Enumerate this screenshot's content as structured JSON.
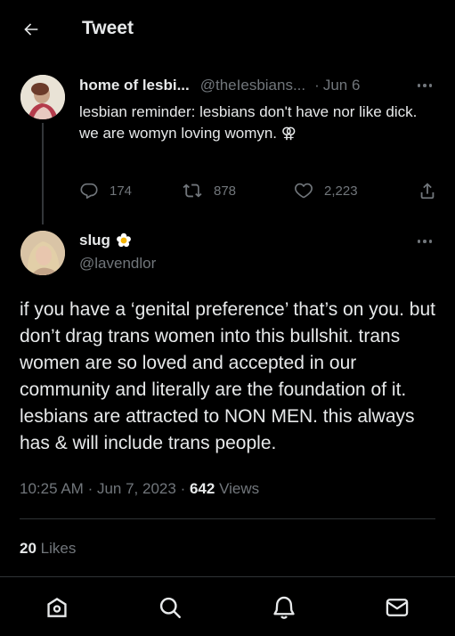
{
  "header": {
    "title": "Tweet"
  },
  "original_tweet": {
    "display_name": "home of lesbi...",
    "handle": "@theIesbians...",
    "separator": "·",
    "date": "Jun 6",
    "text": "lesbian reminder: lesbians don't have nor like dick.\nwe are womyn loving womyn. ⚢",
    "replies": "174",
    "retweets": "878",
    "likes": "2,223"
  },
  "reply_tweet": {
    "display_name": "slug",
    "handle": "@lavendlor",
    "text": "if you have a ‘genital preference’ that’s on you. but don’t drag trans women into this bullshit. trans women are so loved and accepted in our community and literally are the foundation of it. lesbians are attracted to NON MEN. this always has & will include trans people.",
    "time": "10:25 AM",
    "separator": "·",
    "date": "Jun 7, 2023",
    "separator2": "·",
    "views_count": "642",
    "views_label": "Views",
    "likes_count": "20",
    "likes_label": "Likes"
  },
  "icons": [
    "back-arrow-icon",
    "more-icon",
    "reply-icon",
    "retweet-icon",
    "like-icon",
    "share-icon",
    "flower-emoji-icon",
    "home-icon",
    "search-icon",
    "notifications-icon",
    "messages-icon"
  ],
  "colors": {
    "background": "#000000",
    "text": "#e7e9ea",
    "muted": "#71767b",
    "divider": "#2f3336"
  }
}
